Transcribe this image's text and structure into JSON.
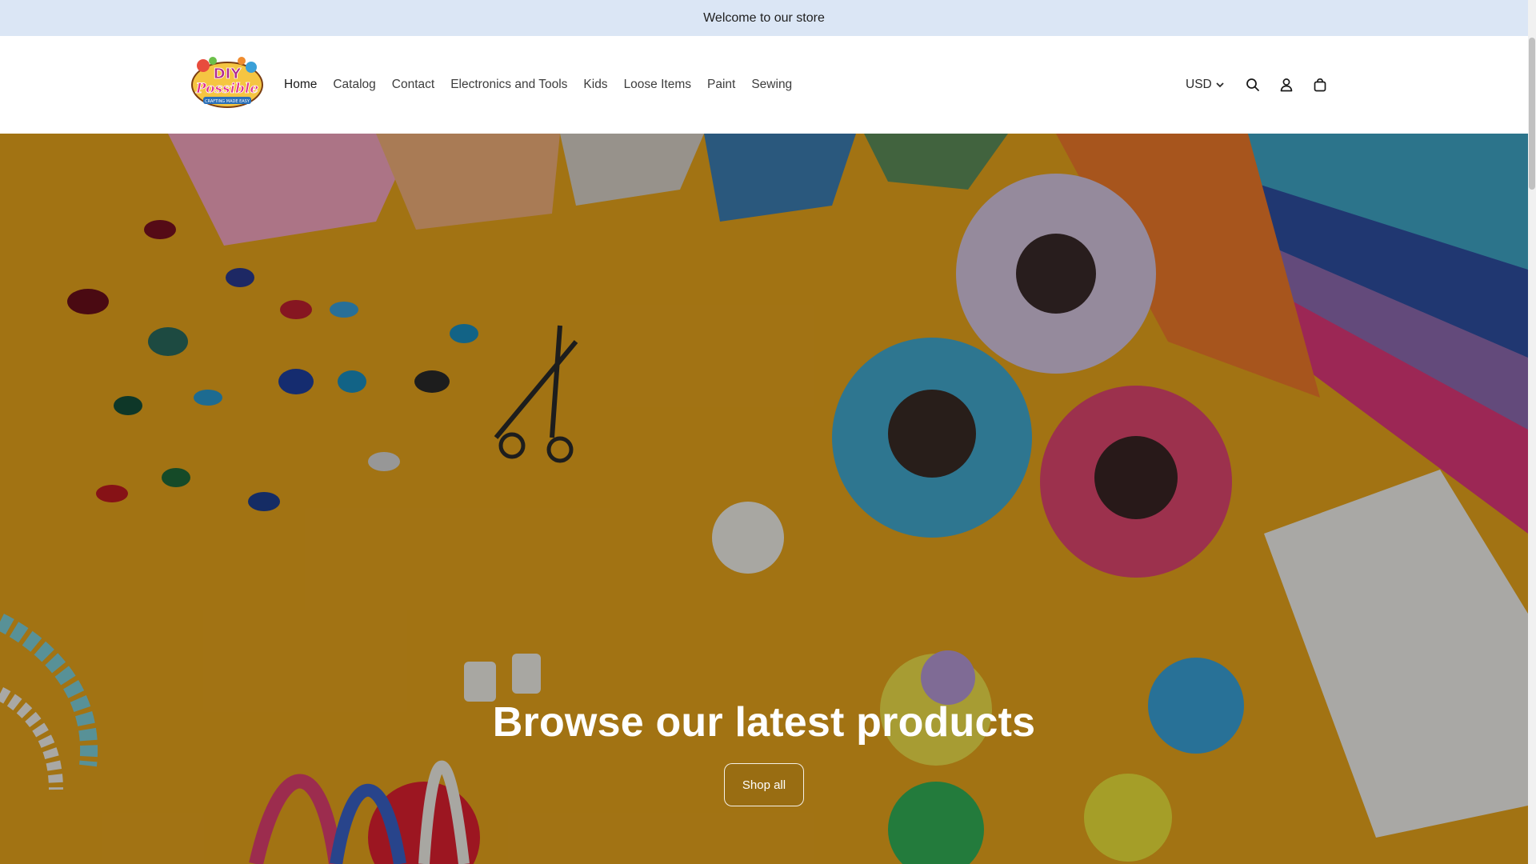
{
  "announcement": {
    "text": "Welcome to our store"
  },
  "header": {
    "logo": {
      "text": "DIY Possible",
      "tagline": "CRAFTING MADE EASY"
    },
    "nav": [
      {
        "label": "Home",
        "active": true
      },
      {
        "label": "Catalog"
      },
      {
        "label": "Contact"
      },
      {
        "label": "Electronics and Tools"
      },
      {
        "label": "Kids"
      },
      {
        "label": "Loose Items"
      },
      {
        "label": "Paint"
      },
      {
        "label": "Sewing"
      }
    ],
    "currency": "USD",
    "icons": [
      "search-icon",
      "account-icon",
      "cart-icon"
    ]
  },
  "hero": {
    "title": "Browse our latest products",
    "button_label": "Shop all",
    "background_color": "#e8a51c"
  },
  "colors": {
    "announcement_bg": "#dbe6f5",
    "header_bg": "#ffffff"
  }
}
